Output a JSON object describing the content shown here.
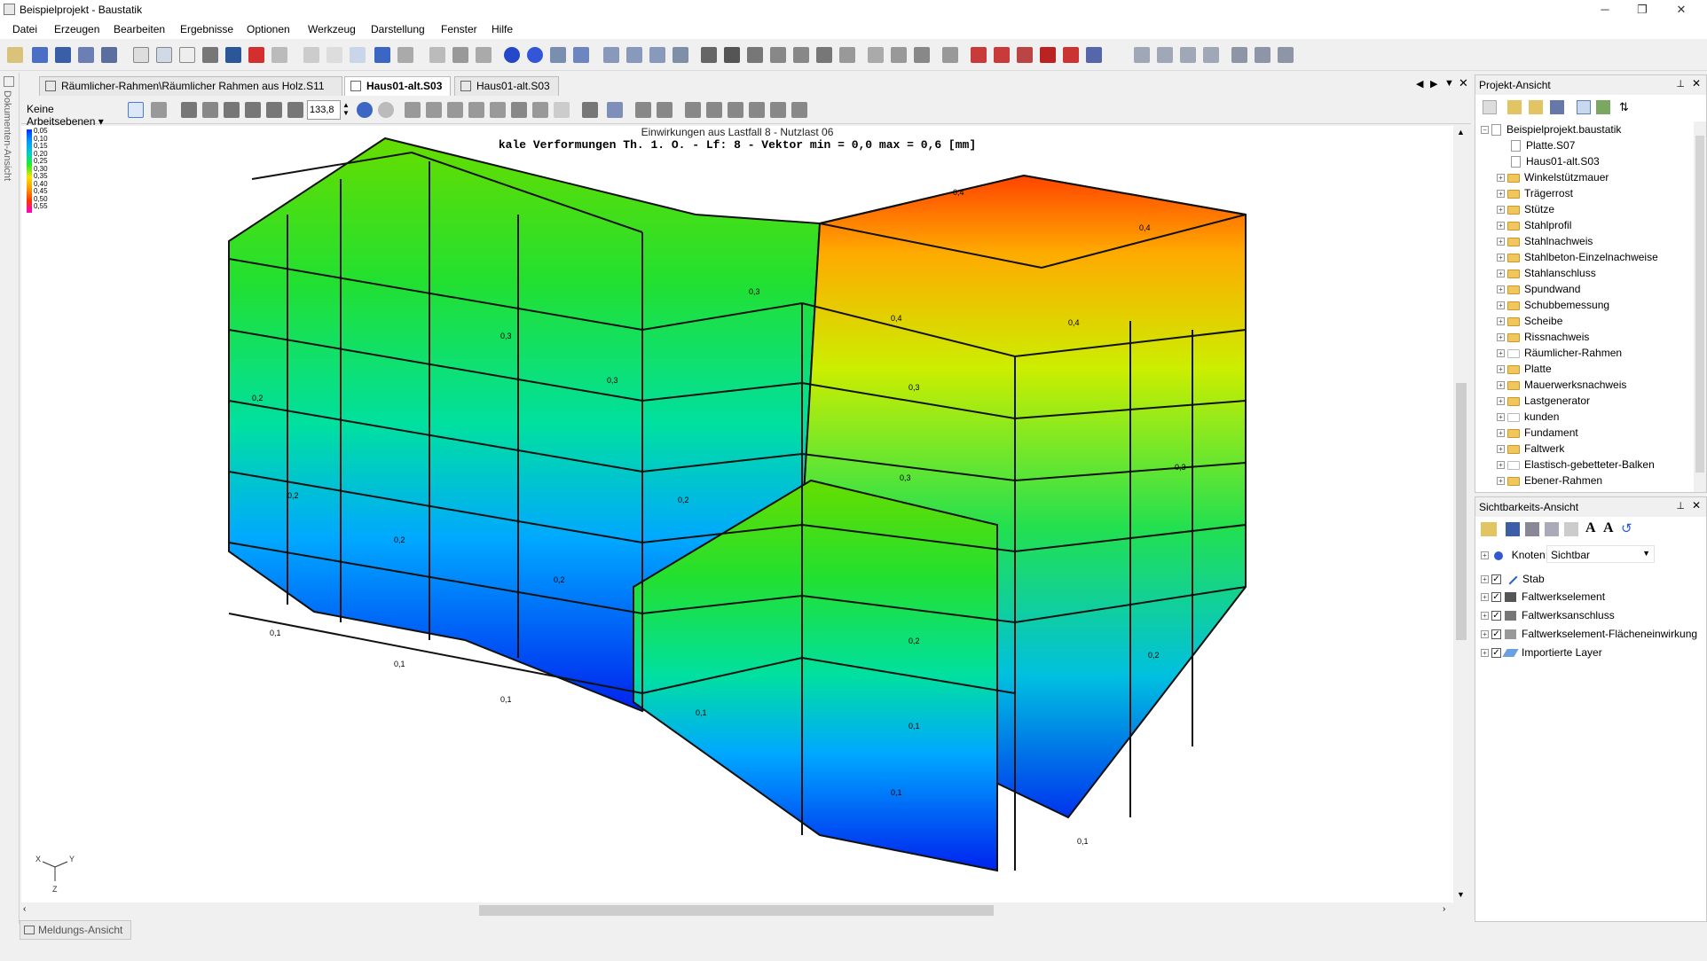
{
  "window": {
    "title": "Beispielprojekt - Baustatik"
  },
  "menu": [
    "Datei",
    "Erzeugen",
    "Bearbeiten",
    "Ergebnisse",
    "Optionen",
    "Werkzeug",
    "Darstellung",
    "Fenster",
    "Hilfe"
  ],
  "left_strip": {
    "label": "Dokumenten-Ansicht"
  },
  "doc_tabs": [
    {
      "label": "Räumlicher-Rahmen\\Räumlicher Rahmen aus Holz.S11",
      "active": false
    },
    {
      "label": "Haus01-alt.S03",
      "active": true
    },
    {
      "label": "Haus01-alt.S03",
      "active": false
    }
  ],
  "view_toolbar": {
    "workplane": "Keine Arbeitsebenen",
    "zoom_value": "133,8"
  },
  "canvas": {
    "title_line1": "Einwirkungen aus Lastfall 8 - Nutzlast 06",
    "title_line2": "kale Verformungen Th. 1. O. - Lf: 8 - Vektor min = 0,0 max = 0,6 [mm]",
    "legend": [
      "0,05",
      "0,10",
      "0,15",
      "0,20",
      "0,25",
      "0,30",
      "0,35",
      "0,40",
      "0,45",
      "0,50",
      "0,55"
    ],
    "legend_colors": [
      "#0033ff",
      "#0066ff",
      "#0099ff",
      "#00cccc",
      "#00e08a",
      "#22ee22",
      "#88ee00",
      "#ffe000",
      "#ff9900",
      "#ff3300",
      "#ff00cc"
    ],
    "axes": {
      "x": "X",
      "y": "Y",
      "z": "Z"
    },
    "value_labels": [
      "0,1",
      "0,1",
      "0,1",
      "0,1",
      "0,1",
      "0,1",
      "0,2",
      "0,2",
      "0,2",
      "0,2",
      "0,2",
      "0,2",
      "0,3",
      "0,3",
      "0,3",
      "0,3",
      "0,3",
      "0,4",
      "0,4",
      "0,4",
      "0,4",
      "0,1",
      "0,2",
      "0,3"
    ]
  },
  "messages_tab": {
    "label": "Meldungs-Ansicht"
  },
  "project_panel": {
    "title": "Projekt-Ansicht",
    "root": "Beispielprojekt.baustatik",
    "files": [
      "Platte.S07",
      "Haus01-alt.S03"
    ],
    "folders": [
      "Winkelstützmauer",
      "Trägerrost",
      "Stütze",
      "Stahlprofil",
      "Stahlnachweis",
      "Stahlbeton-Einzelnachweise",
      "Stahlanschluss",
      "Spundwand",
      "Schubbemessung",
      "Scheibe",
      "Rissnachweis",
      "Räumlicher-Rahmen",
      "Platte",
      "Mauerwerksnachweis",
      "Lastgenerator",
      "kunden",
      "Fundament",
      "Faltwerk",
      "Elastisch-gebetteter-Balken",
      "Ebener-Rahmen"
    ]
  },
  "visibility_panel": {
    "title": "Sichtbarkeits-Ansicht",
    "knoten_label": "Knoten:",
    "knoten_value": "Sichtbar",
    "items": [
      "Stab",
      "Faltwerkselement",
      "Faltwerksanschluss",
      "Faltwerkselement-Flächeneinwirkung",
      "Importierte Layer"
    ]
  }
}
